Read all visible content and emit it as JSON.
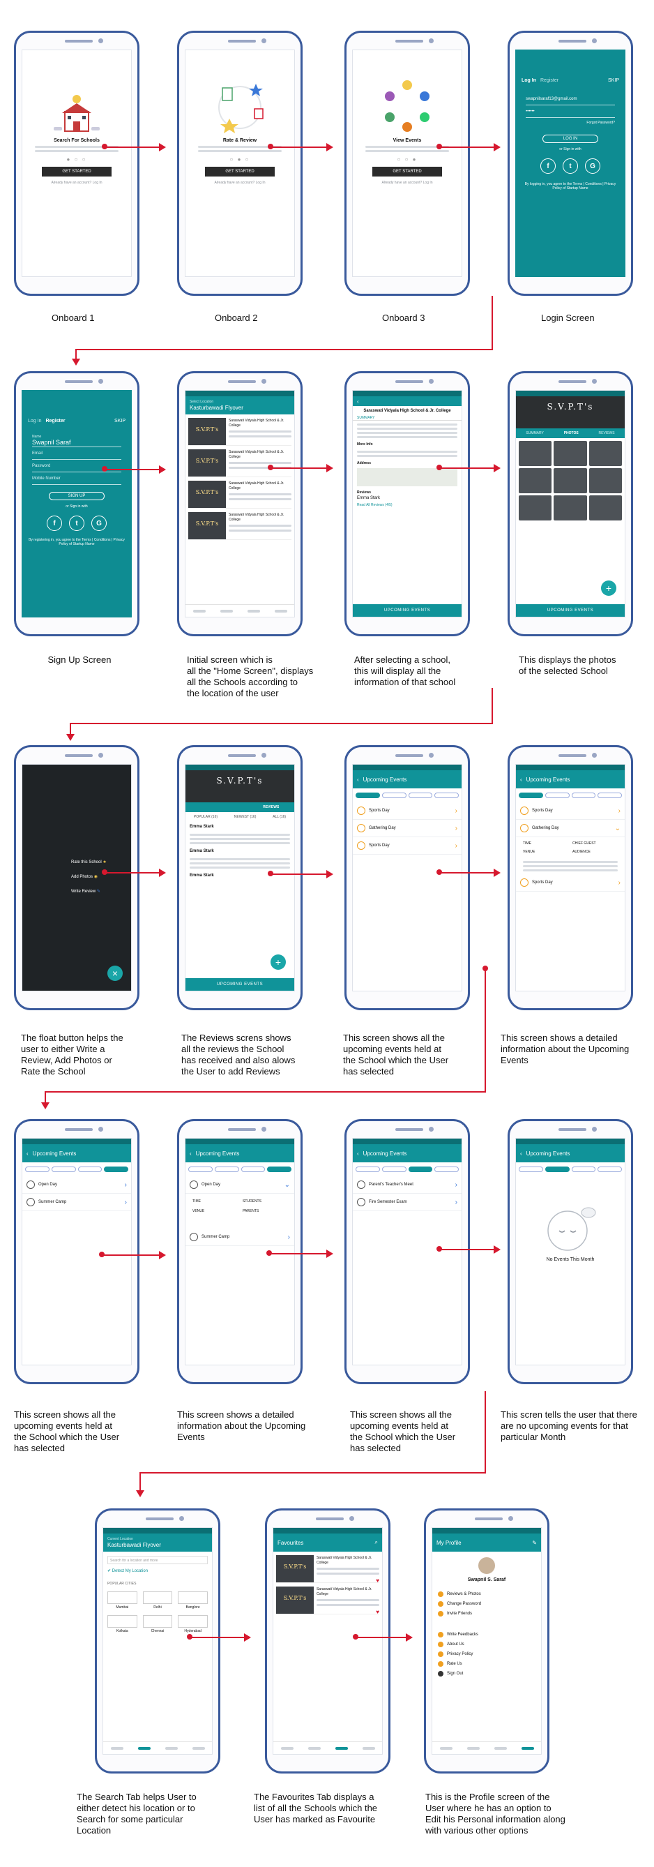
{
  "captions": {
    "c1": "Onboard 1",
    "c2": "Onboard 2",
    "c3": "Onboard 3",
    "c4": "Login Screen",
    "c5": "Sign Up Screen",
    "c6": "Initial screen which is\nall the \"Home Screen\", displays\nall the Schools according to\nthe location of the user",
    "c7": "After selecting a school,\nthis will display all the\ninformation of that school",
    "c8": "This displays the photos\nof the selected School",
    "c9": "The float button helps the\nuser to  either Write a\nReview, Add Photos or\nRate the School",
    "c10": "The Reviews screns shows\nall the reviews the School\nhas received and also alows\nthe User to add Reviews",
    "c11": "This screen shows all the\nupcoming events held at\nthe School which the User\nhas selected",
    "c12": "This screen shows a detailed\ninformation about the Upcoming\nEvents",
    "c13": "This screen shows all the\nupcoming events held at\nthe School which the User\nhas selected",
    "c14": "This screen shows a detailed\ninformation about the Upcoming\nEvents",
    "c15": "This screen shows all the\nupcoming events held at\nthe School which the User\nhas selected",
    "c16": "This scren tells the user that there\nare no upcoming events for that\nparticular Month",
    "c17": "The Search Tab helps User to\neither detect his location or to\nSearch for some particular\nLocation",
    "c18": "The Favourites Tab displays a\nlist of all the Schools which the\nUser has marked as Favourite",
    "c19": "This is the Profile screen of the\nUser where he has an option to\nEdit his Personal information along\nwith various other options"
  },
  "screens": {
    "onboard1": {
      "title": "Search For Schools",
      "button": "GET STARTED",
      "footer": "Already have an account? Log In"
    },
    "onboard2": {
      "title": "Rate & Review",
      "button": "GET STARTED",
      "footer": "Already have an account? Log In"
    },
    "onboard3": {
      "title": "View Events",
      "button": "GET STARTED",
      "footer": "Already have an account? Log In"
    },
    "login": {
      "tab_login": "Log In",
      "tab_register": "Register",
      "skip": "SKIP",
      "email": "swapnilsaraf13@gmail.com",
      "password": "••••••",
      "forgot": "Forgot Password?",
      "button": "LOG IN",
      "or": "or Sign in with",
      "terms": "By logging in, you agree to the Terms | Conditions | Privacy Policy of Startup Name"
    },
    "signup": {
      "tab_login": "Log In",
      "tab_register": "Register",
      "skip": "SKIP",
      "name_label": "Name",
      "name_value": "Swapnil Saraf",
      "email": "Email",
      "password": "Password",
      "mobile": "Mobile Number",
      "button": "SIGN UP",
      "or": "or Sign in with",
      "terms": "By registering in, you agree to the Terms | Conditions | Privacy Policy of Startup Name"
    },
    "home": {
      "location_label": "Select Location",
      "location": "Kasturbawadi Flyover",
      "school": "Saraswati Vidyala High School & Jr. College",
      "brand": "S.V.P.T's"
    },
    "detail": {
      "name": "Saraswati Vidyala High School & Jr. College",
      "tab": "SUMMARY",
      "address_label": "Address",
      "more_info": "More Info",
      "reviews_label": "Reviews",
      "reviewer": "Emma Stark",
      "read_all": "Read All Reviews (4/5)",
      "banner": "UPCOMING EVENTS"
    },
    "photos": {
      "brand": "S.V.P.T's",
      "tabs": [
        "SUMMARY",
        "PHOTOS",
        "REVIEWS"
      ],
      "banner": "UPCOMING EVENTS"
    },
    "fab_menu": {
      "items": [
        "Rate this School",
        "Add Photos",
        "Write Review"
      ]
    },
    "reviews": {
      "brand": "S.V.P.T's",
      "tab_active": "REVIEWS",
      "filters": [
        "POPULAR (16)",
        "NEWEST (16)",
        "ALL (16)"
      ],
      "reviewer": "Emma Stark",
      "banner": "UPCOMING EVENTS"
    },
    "events": {
      "title": "Upcoming Events",
      "items": [
        "Sports Day",
        "Gathering Day",
        "Sports Day"
      ]
    },
    "event_detail": {
      "title": "Upcoming Events",
      "items": [
        "Sports Day",
        "Gathering Day",
        "Sports Day"
      ],
      "fields": [
        "TIME",
        "CHIEF GUEST",
        "VENUE",
        "AUDIENCE"
      ]
    },
    "events2": {
      "title": "Upcoming Events",
      "items": [
        "Open Day",
        "Summer Camp"
      ]
    },
    "event_detail2": {
      "title": "Upcoming Events",
      "items": [
        "Open Day",
        "Summer Camp"
      ],
      "fields": [
        "TIME",
        "STUDENTS",
        "VENUE",
        "PARENTS"
      ]
    },
    "events3": {
      "title": "Upcoming Events",
      "items": [
        "Parent's Teacher's Meet",
        "Fire Semester Exam"
      ]
    },
    "no_events": {
      "title": "Upcoming Events",
      "message": "No Events This Month"
    },
    "search": {
      "location_label": "Current Location",
      "location": "Kasturbawadi Flyover",
      "placeholder": "Search for a location and more",
      "detect": "Detect My Location",
      "popular": "POPULAR CITIES",
      "cities": [
        "Mumbai",
        "Delhi",
        "Banglore",
        "Kolkata",
        "Chennai",
        "Hyderabad"
      ]
    },
    "favourites": {
      "title": "Favourites",
      "school": "Saraswati Vidyala High School & Jr. College",
      "brand": "S.V.P.T's"
    },
    "profile": {
      "title": "My Profile",
      "name": "Swapnil S. Saraf",
      "profile_items": [
        "Reviews & Photos",
        "Change Password",
        "Invite Friends"
      ],
      "more_items": [
        "Write Feedbacks",
        "About Us",
        "Privacy Policy",
        "Rate Us",
        "Sign Out"
      ]
    }
  },
  "colors": {
    "teal": "#109399",
    "accent_red": "#d6182e",
    "phone_frame": "#3a5a9c",
    "orange": "#f0a020"
  }
}
